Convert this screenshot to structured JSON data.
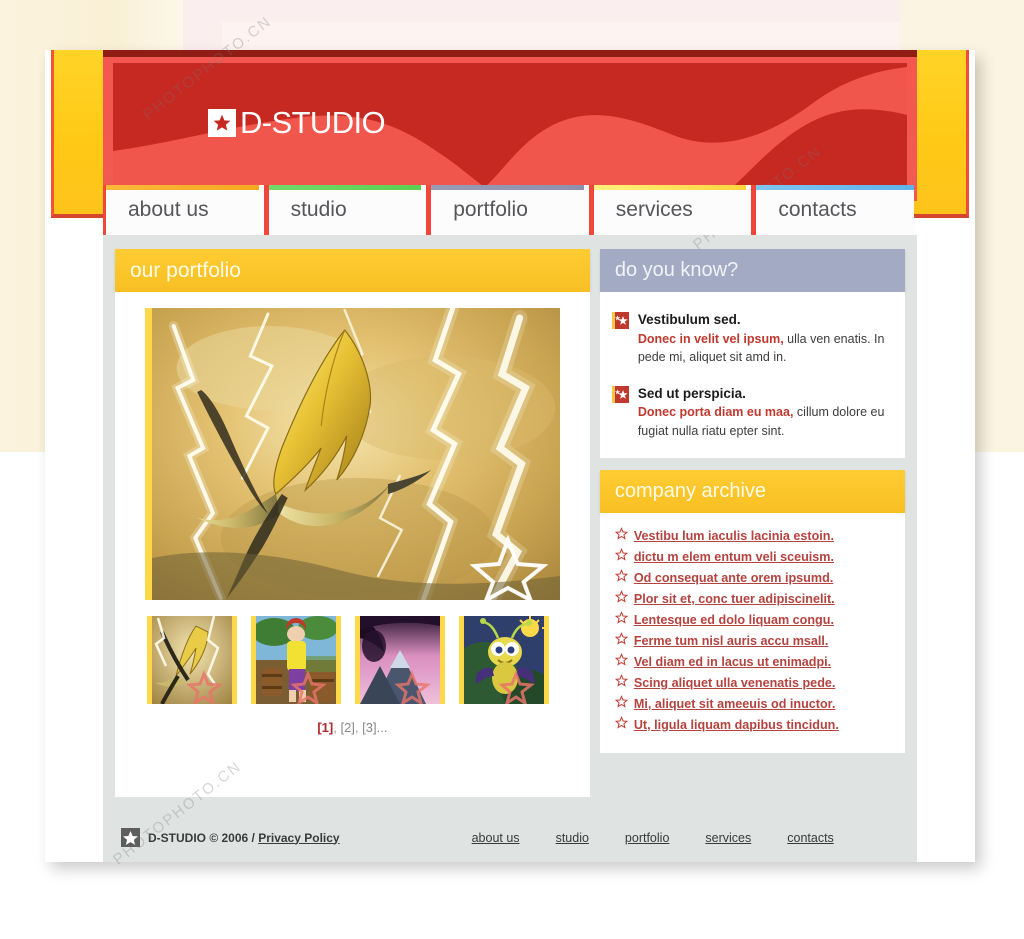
{
  "site": {
    "logo_text": "D-STUDIO",
    "logo_icon": "star-square-icon"
  },
  "nav": {
    "items": [
      {
        "label": "about us",
        "accent": "#f6a91f"
      },
      {
        "label": "studio",
        "accent": "#5ccf52"
      },
      {
        "label": "portfolio",
        "accent": "#8e90ad"
      },
      {
        "label": "services",
        "accent": "#ffd53c"
      },
      {
        "label": "contacts",
        "accent": "#5fb3ec"
      }
    ]
  },
  "portfolio": {
    "heading": "our portfolio",
    "main_image_alt": "golden dragon with lightning",
    "thumbnails": [
      {
        "alt": "golden dragon thumbnail"
      },
      {
        "alt": "cartoon man with barrels thumbnail"
      },
      {
        "alt": "purple mountain blossom thumbnail"
      },
      {
        "alt": "cartoon bug with sun thumbnail"
      }
    ],
    "pagination": {
      "current": "[1]",
      "separator": ", ",
      "pages": [
        "[2]",
        "[3]"
      ],
      "more": "..."
    }
  },
  "did_you_know": {
    "heading": "do you know?",
    "items": [
      {
        "title": "Vestibulum sed.",
        "lead": "Donec in velit vel ipsum,",
        "body": " ulla ven enatis. In pede mi, aliquet sit amd in."
      },
      {
        "title": "Sed ut perspicia.",
        "lead": "Donec porta diam eu maa,",
        "body": " cillum dolore eu fugiat nulla riatu epter sint."
      }
    ]
  },
  "archive": {
    "heading": "company archive",
    "links": [
      "Vestibu lum iaculis lacinia estoin.",
      "dictu m elem entum veli sceuism.",
      "Od consequat ante orem ipsumd.",
      "Plor sit et, conc tuer adipiscinelit.",
      "Lentesque ed dolo liquam congu.",
      "Ferme tum nisl auris accu msall.",
      "Vel diam ed in lacus ut enimadpi.",
      "Scing aliquet ulla venenatis pede.",
      "Mi, aliquet sit ameeuis od inuctor.",
      "Ut, ligula liquam dapibus tincidun."
    ]
  },
  "footer": {
    "copyright": "D-STUDIO © 2006 / ",
    "privacy": "Privacy Policy",
    "links": [
      "about us",
      "studio",
      "portfolio",
      "services",
      "contacts"
    ]
  },
  "watermarks": {
    "text1": "PHOTOPHOTO.CN",
    "text2": "PHOTOPHOTO.CN",
    "text3": "PHOTOPHOTO.CN"
  },
  "colors": {
    "red": "#c62822",
    "red_light": "#f1584d",
    "yellow": "#ffc916",
    "gold_header": "#f8bf23",
    "blue_gray": "#a3abc4",
    "panel_gray": "#dfe4e2",
    "link_red": "#b4433f"
  }
}
